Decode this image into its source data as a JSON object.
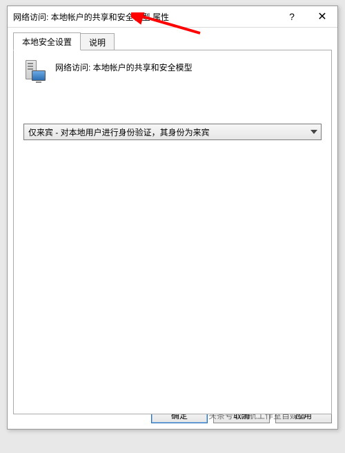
{
  "dialog": {
    "title": "网络访问: 本地帐户的共享和安全模型 属性",
    "help_label": "?",
    "close_label": "✕"
  },
  "tabs": {
    "items": [
      {
        "label": "本地安全设置",
        "active": true
      },
      {
        "label": "说明",
        "active": false
      }
    ]
  },
  "heading": {
    "text": "网络访问: 本地帐户的共享和安全模型"
  },
  "dropdown": {
    "selected": "仅来宾 - 对本地用户进行身份验证，其身份为来宾"
  },
  "buttons": {
    "ok": "确定",
    "cancel": "取消",
    "apply": "应用"
  },
  "watermark": "头条号 / 启航工作室自媒体",
  "annotations": {
    "arrow_top": "red-arrow",
    "arrow_mid": "red-arrow"
  }
}
